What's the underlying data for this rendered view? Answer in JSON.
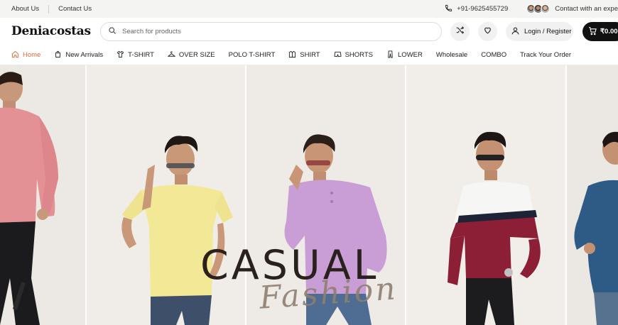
{
  "topbar": {
    "about": "About Us",
    "contact": "Contact Us",
    "phone": "+91-9625455729",
    "experts_text": "Contact with an expe"
  },
  "header": {
    "logo": "Deniacostas",
    "search_placeholder": "Search for products",
    "login_label": "Login / Register",
    "cart_total": "₹0.00"
  },
  "nav": {
    "items": [
      {
        "label": "Home",
        "icon": "home-icon",
        "active": true
      },
      {
        "label": "New Arrivals",
        "icon": "bag-icon"
      },
      {
        "label": "T-SHIRT",
        "icon": "tshirt-icon"
      },
      {
        "label": "OVER SIZE",
        "icon": "hanger-icon"
      },
      {
        "label": "POLO T-SHIRT",
        "icon": ""
      },
      {
        "label": "SHIRT",
        "icon": "shirt-icon"
      },
      {
        "label": "SHORTS",
        "icon": "shorts-icon"
      },
      {
        "label": "LOWER",
        "icon": "trousers-icon"
      },
      {
        "label": "Wholesale",
        "icon": ""
      },
      {
        "label": "COMBO",
        "icon": ""
      },
      {
        "label": "Track Your Order",
        "icon": ""
      }
    ]
  },
  "hero": {
    "title": "CASUAL",
    "subtitle": "Fashion"
  },
  "colors": {
    "accent": "#e0673a",
    "cart_bg": "#111111",
    "hero_text": "#2a211c"
  }
}
